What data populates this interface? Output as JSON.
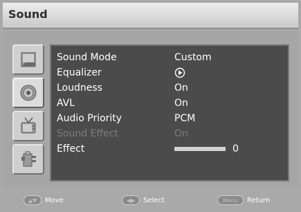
{
  "window": {
    "title": "Sound"
  },
  "sidebar": {
    "icons": [
      {
        "name": "picture-icon"
      },
      {
        "name": "sound-icon",
        "selected": true
      },
      {
        "name": "channel-icon"
      },
      {
        "name": "setup-icon"
      }
    ]
  },
  "menu": {
    "items": [
      {
        "label": "Sound Mode",
        "value": "Custom"
      },
      {
        "label": "Equalizer",
        "value_icon": "play-circle-icon"
      },
      {
        "label": "Loudness",
        "value": "On"
      },
      {
        "label": "AVL",
        "value": "On"
      },
      {
        "label": "Audio Priority",
        "value": "PCM"
      },
      {
        "label": "Sound Effect",
        "value": "On",
        "disabled": true
      },
      {
        "label": "Effect",
        "value": "0",
        "level": 1.0
      }
    ]
  },
  "footer": {
    "move": {
      "key_icon": "updown-arrows-icon",
      "label": "Move"
    },
    "select": {
      "key_icon": "leftright-arrows-icon",
      "label": "Select"
    },
    "return": {
      "key_label": "Menu",
      "label": "Return"
    }
  },
  "colors": {
    "panel_bg": "#4b4b4b",
    "frame_bg": "#a9a9a9",
    "text": "#ffffff",
    "disabled_text": "#7c7c7c"
  }
}
